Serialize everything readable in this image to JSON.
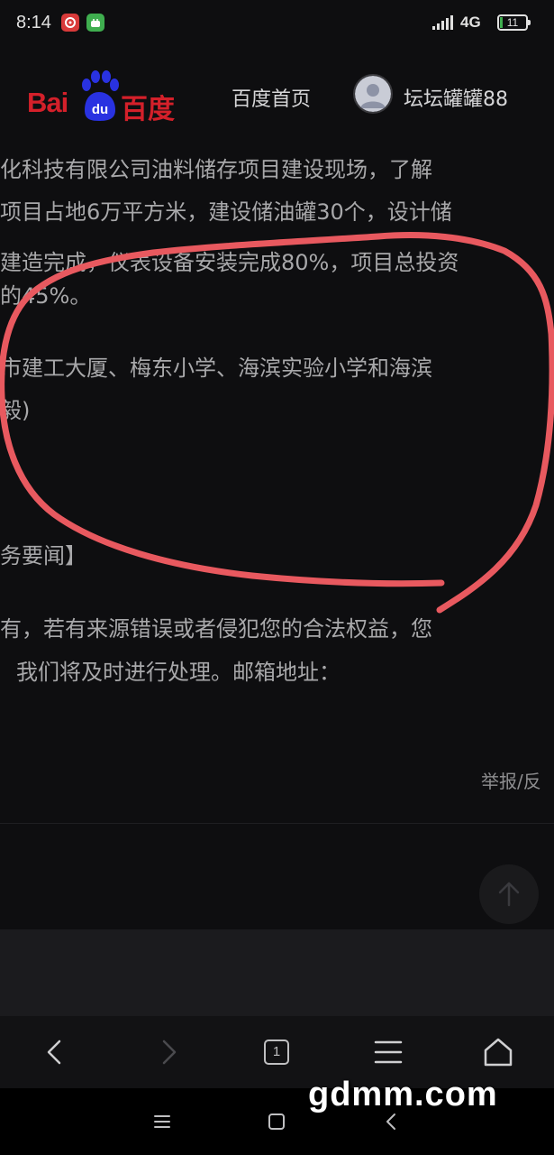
{
  "status_bar": {
    "time": "8:14",
    "network": "4G",
    "battery": "11"
  },
  "header": {
    "logo_latin": "Bai",
    "logo_du": "du",
    "logo_chinese": "百度",
    "nav_home": "百度首页",
    "user_name": "坛坛罐罐88"
  },
  "article": {
    "lines": [
      "化科技有限公司油料储存项目建设现场，了解",
      "项目占地6万平方米，建设储油罐30个，设计储",
      "建造完成，仪表设备安装完成80%，项目总投资",
      "的45%。",
      "市建工大厦、梅东小学、海滨实验小学和海滨",
      "毅)",
      "务要闻】",
      "有，若有来源错误或者侵犯您的合法权益，您",
      "我们将及时进行处理。邮箱地址："
    ],
    "report": "举报/反"
  },
  "browser_nav": {
    "tab_count": "1"
  },
  "watermark": "gdmm.com",
  "colors": {
    "background": "#0e0e10",
    "text": "#a8a8aa",
    "logo_red": "#d4202a",
    "logo_blue": "#2932e1",
    "annotation_red": "#e8595f"
  }
}
